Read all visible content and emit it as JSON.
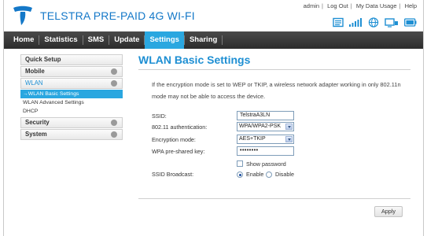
{
  "header": {
    "title": "TELSTRA PRE-PAID 4G WI-FI",
    "links": [
      "admin",
      "Log Out",
      "My Data Usage",
      "Help"
    ],
    "status_icons": [
      "sms-envelope-icon",
      "signal-bars-icon",
      "globe-icon",
      "wifi-device-icon",
      "battery-icon"
    ],
    "brand_color": "#1478c8"
  },
  "nav": {
    "items": [
      "Home",
      "Statistics",
      "SMS",
      "Update",
      "Settings",
      "Sharing"
    ],
    "active": "Settings",
    "accent": "#2aa7e0"
  },
  "sidebar": {
    "quick_setup": "Quick Setup",
    "mobile": "Mobile",
    "wlan": "WLAN",
    "wlan_sub": [
      "→WLAN Basic Settings",
      "WLAN Advanced Settings",
      "DHCP"
    ],
    "security": "Security",
    "system": "System"
  },
  "main": {
    "title": "WLAN Basic Settings",
    "notice": "If the encryption mode is set to WEP or TKIP, a wireless network adapter working in only 802.11n mode may not be able to access the device.",
    "form": {
      "ssid_label": "SSID:",
      "ssid_value": "TelstraA3LN",
      "auth_label": "802.11 authentication:",
      "auth_value": "WPA/WPA2-PSK",
      "enc_label": "Encryption mode:",
      "enc_value": "AES+TKIP",
      "psk_label": "WPA pre-shared key:",
      "psk_value": "••••••••",
      "show_password": "Show password",
      "broadcast_label": "SSID Broadcast:",
      "enable": "Enable",
      "disable": "Disable"
    },
    "apply": "Apply"
  }
}
